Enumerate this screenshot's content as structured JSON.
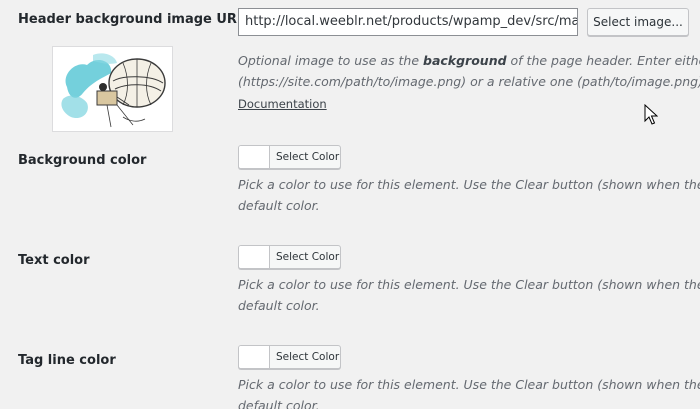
{
  "header_bg": {
    "label": "Header background image URL",
    "url_value": "http://local.weeblr.net/products/wpamp_dev/src/main",
    "select_button": "Select image...",
    "description_line1_a": "Optional image to use as the ",
    "description_line1_b": "background",
    "description_line1_c": " of the page header. Enter either a",
    "description_line2": "(https://site.com/path/to/image.png) or a relative one (path/to/image.png)",
    "doc_link": "Documentation",
    "thumbnail_icon": "image-thumbnail"
  },
  "color_fields": [
    {
      "label": "Background color",
      "button": "Select Color",
      "swatch_color": "#ffffff",
      "desc_line1": "Pick a color to use for this element. Use the Clear button (shown when the co",
      "desc_line2": "default color."
    },
    {
      "label": "Text color",
      "button": "Select Color",
      "swatch_color": "#ffffff",
      "desc_line1": "Pick a color to use for this element. Use the Clear button (shown when the co",
      "desc_line2": "default color."
    },
    {
      "label": "Tag line color",
      "button": "Select Color",
      "swatch_color": "#ffffff",
      "desc_line1": "Pick a color to use for this element. Use the Clear button (shown when the co",
      "desc_line2": "default color."
    }
  ],
  "colors": {
    "background": "#f1f1f1",
    "text": "#23282d",
    "description": "#646970"
  },
  "cursor_icon": "mouse-pointer-icon"
}
